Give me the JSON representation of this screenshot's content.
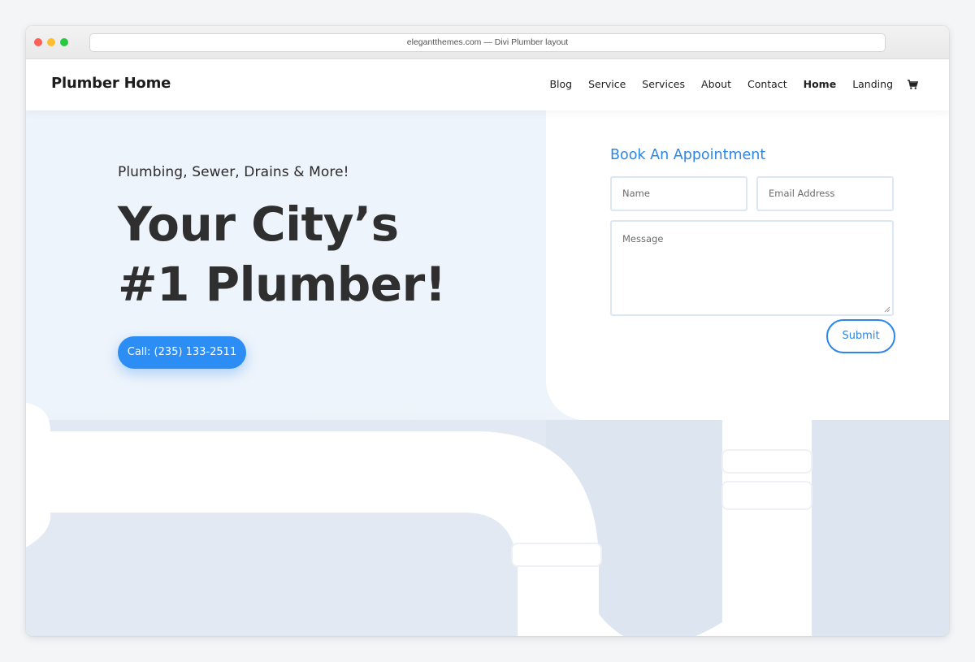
{
  "browser": {
    "url": "elegantthemes.com — Divi Plumber layout"
  },
  "header": {
    "logo": "Plumber Home",
    "nav": [
      {
        "label": "Blog"
      },
      {
        "label": "Service"
      },
      {
        "label": "Services"
      },
      {
        "label": "About"
      },
      {
        "label": "Contact"
      },
      {
        "label": "Home",
        "active": true
      },
      {
        "label": "Landing"
      }
    ],
    "cart_icon": "cart-icon"
  },
  "hero": {
    "subtitle": "Plumbing, Sewer, Drains & More!",
    "headline": "Your City’s #1 Plumber!",
    "call_button": "Call: (235) 133-2511"
  },
  "form": {
    "title": "Book An Appointment",
    "name_placeholder": "Name",
    "email_placeholder": "Email Address",
    "message_placeholder": "Message",
    "submit_label": "Submit"
  },
  "colors": {
    "accent": "#2c8df5",
    "hero_background": "#eef4fb",
    "heading_text": "#2f2f2f"
  }
}
